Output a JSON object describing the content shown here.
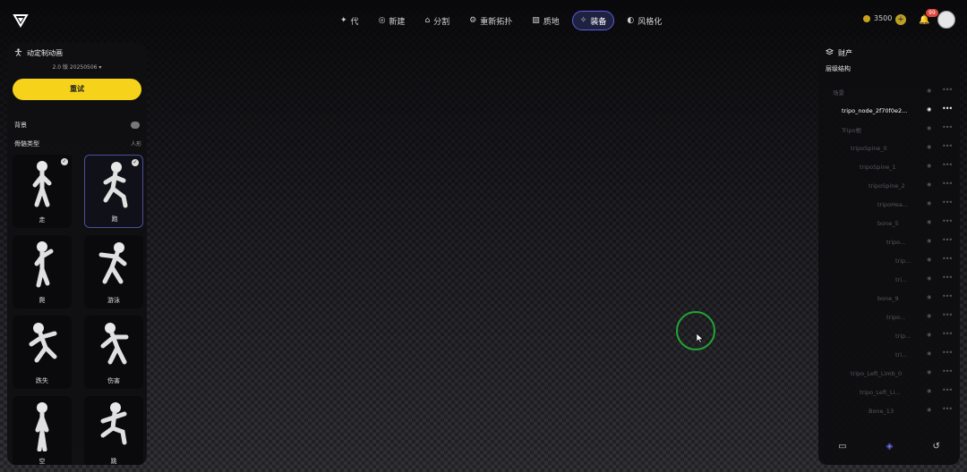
{
  "nav": {
    "items": [
      {
        "icon": "✦",
        "label": "代",
        "active": false
      },
      {
        "icon": "◎",
        "label": "新建",
        "active": false
      },
      {
        "icon": "⌂",
        "label": "分割",
        "active": false
      },
      {
        "icon": "⚙",
        "label": "重新拓扑",
        "active": false
      },
      {
        "icon": "▨",
        "label": "质地",
        "active": false
      },
      {
        "icon": "✧",
        "label": "装备",
        "active": true
      },
      {
        "icon": "◐",
        "label": "风格化",
        "active": false
      }
    ]
  },
  "header": {
    "credits": "3500",
    "notification_count": "99"
  },
  "left_panel": {
    "title": "动定制动画",
    "subtitle": "2.0 版 20250506 ▾",
    "retry_label": "重试",
    "background_label": "背景",
    "skeleton_type_label": "骨骼类型",
    "skeleton_type_value": "人形",
    "animations": [
      {
        "label": "走",
        "selected": false,
        "checked": true
      },
      {
        "label": "跑",
        "selected": true,
        "checked": true
      },
      {
        "label": "爬",
        "selected": false,
        "checked": false
      },
      {
        "label": "游泳",
        "selected": false,
        "checked": false
      },
      {
        "label": "跌失",
        "selected": false,
        "checked": false
      },
      {
        "label": "伤害",
        "selected": false,
        "checked": false
      },
      {
        "label": "空",
        "selected": false,
        "checked": false
      },
      {
        "label": "跳",
        "selected": false,
        "checked": false
      }
    ]
  },
  "right_panel": {
    "title": "财产",
    "subtitle": "层级结构",
    "tree": [
      {
        "name": "场景",
        "indent": 1,
        "highlight": false
      },
      {
        "name": "tripo_node_2f70f0e2...",
        "indent": 2,
        "highlight": true
      },
      {
        "name": "Tripo根",
        "indent": 2,
        "highlight": false
      },
      {
        "name": "tripoSpine_0",
        "indent": 3,
        "highlight": false
      },
      {
        "name": "tripoSpine_1",
        "indent": 4,
        "highlight": false
      },
      {
        "name": "tripoSpine_2",
        "indent": 5,
        "highlight": false
      },
      {
        "name": "tripoHea...",
        "indent": 6,
        "highlight": false
      },
      {
        "name": "bone_5",
        "indent": 6,
        "highlight": false
      },
      {
        "name": "tripo...",
        "indent": 7,
        "highlight": false
      },
      {
        "name": "trip...",
        "indent": 8,
        "highlight": false
      },
      {
        "name": "tri...",
        "indent": 8,
        "highlight": false
      },
      {
        "name": "bone_9",
        "indent": 6,
        "highlight": false
      },
      {
        "name": "tripo...",
        "indent": 7,
        "highlight": false
      },
      {
        "name": "trip...",
        "indent": 8,
        "highlight": false
      },
      {
        "name": "tri...",
        "indent": 8,
        "highlight": false
      },
      {
        "name": "tripo_Left_Limb_0",
        "indent": 3,
        "highlight": false
      },
      {
        "name": "tripo_Left_Li...",
        "indent": 4,
        "highlight": false
      },
      {
        "name": "Bone_13",
        "indent": 5,
        "highlight": false
      }
    ]
  }
}
